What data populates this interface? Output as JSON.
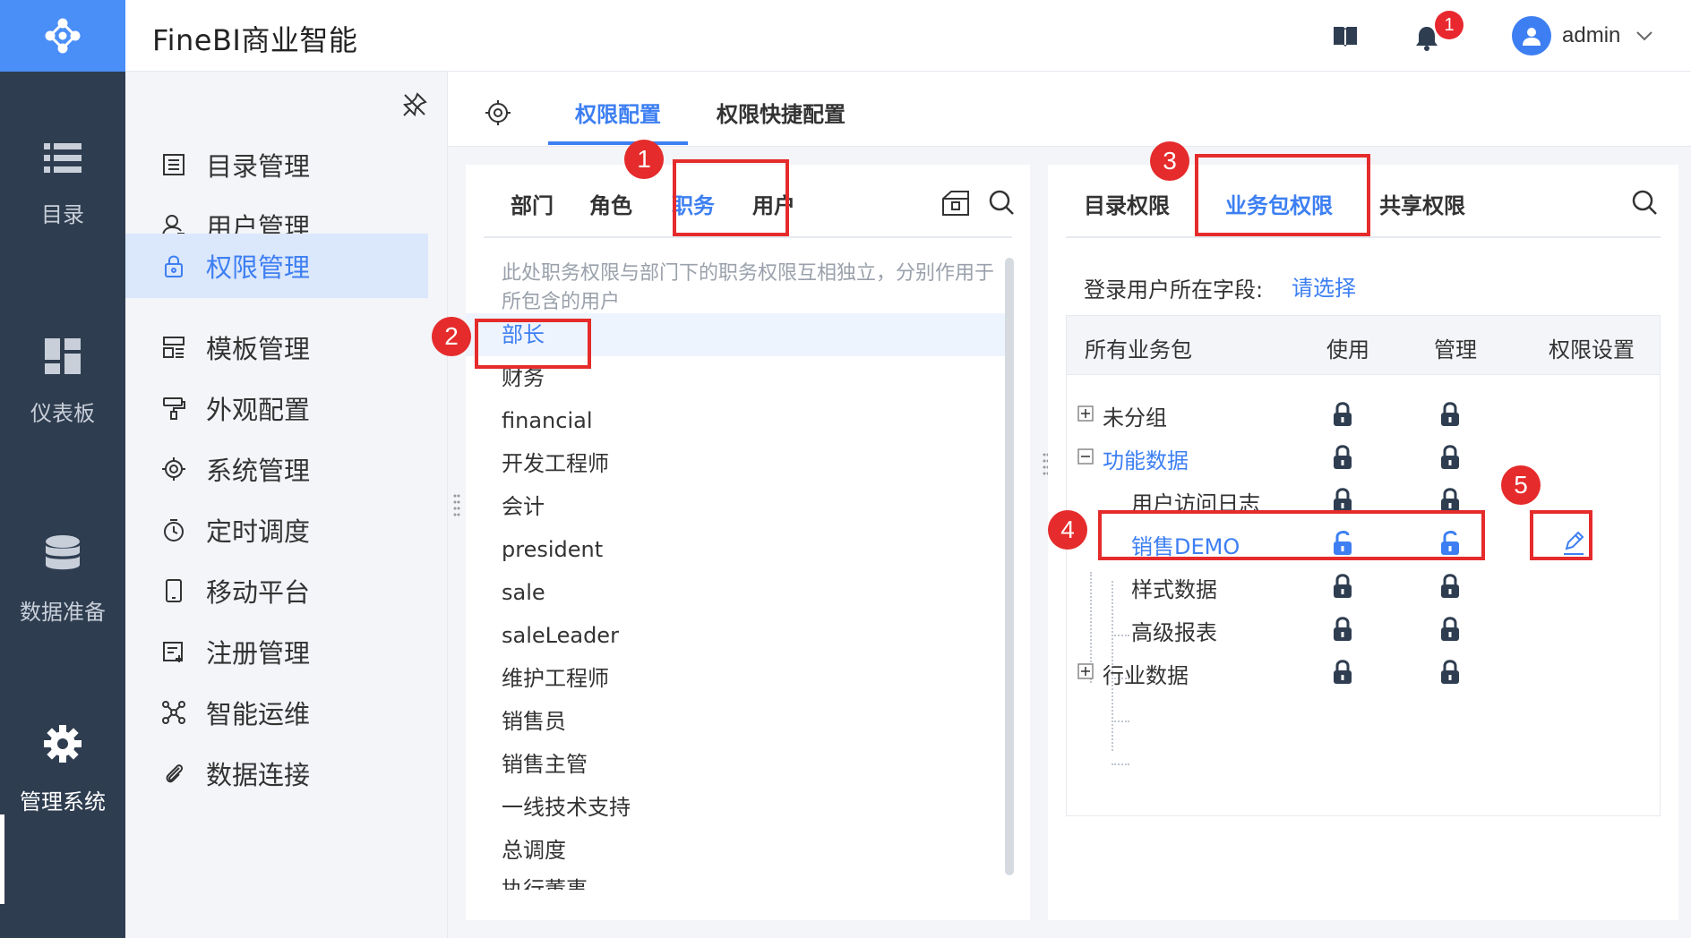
{
  "header": {
    "app_title": "FineBI商业智能",
    "notification_count": "1",
    "user_name": "admin"
  },
  "left_nav": {
    "items": [
      {
        "label": "目录",
        "icon": "list-icon"
      },
      {
        "label": "仪表板",
        "icon": "dashboard-icon"
      },
      {
        "label": "数据准备",
        "icon": "database-icon"
      },
      {
        "label": "管理系统",
        "icon": "gear-icon",
        "active": true
      }
    ]
  },
  "sidebar": {
    "items": [
      {
        "label": "目录管理",
        "icon": "catalog-icon"
      },
      {
        "label": "用户管理",
        "icon": "user-icon"
      },
      {
        "label": "权限管理",
        "icon": "lock-icon",
        "active": true
      },
      {
        "label": "模板管理",
        "icon": "template-icon"
      },
      {
        "label": "外观配置",
        "icon": "brush-icon"
      },
      {
        "label": "系统管理",
        "icon": "gear-icon"
      },
      {
        "label": "定时调度",
        "icon": "timer-icon"
      },
      {
        "label": "移动平台",
        "icon": "mobile-icon"
      },
      {
        "label": "注册管理",
        "icon": "register-icon"
      },
      {
        "label": "智能运维",
        "icon": "network-icon"
      },
      {
        "label": "数据连接",
        "icon": "link-icon"
      }
    ]
  },
  "main_tabs": {
    "perm_config": "权限配置",
    "perm_quick": "权限快捷配置"
  },
  "left_panel": {
    "tabs": [
      "部门",
      "角色",
      "职务",
      "用户"
    ],
    "active_tab": "职务",
    "note": "此处职务权限与部门下的职务权限互相独立，分别作用于所包含的用户",
    "positions": [
      "部长",
      "财务",
      "financial",
      "开发工程师",
      "会计",
      "president",
      "sale",
      "saleLeader",
      "维护工程师",
      "销售员",
      "销售主管",
      "一线技术支持",
      "总调度",
      "执行董事"
    ],
    "selected": "部长"
  },
  "right_panel": {
    "tabs": [
      "目录权限",
      "业务包权限",
      "共享权限"
    ],
    "active_tab": "业务包权限",
    "login_field_label": "登录用户所在字段:",
    "login_field_select": "请选择",
    "table_headers": [
      "所有业务包",
      "使用",
      "管理",
      "权限设置"
    ],
    "tree": [
      {
        "label": "未分组",
        "level": 0,
        "expander": "plus"
      },
      {
        "label": "功能数据",
        "level": 0,
        "expander": "minus"
      },
      {
        "label": "用户访问日志",
        "level": 1
      },
      {
        "label": "销售DEMO",
        "level": 1,
        "unlocked": true
      },
      {
        "label": "样式数据",
        "level": 1
      },
      {
        "label": "高级报表",
        "level": 1
      },
      {
        "label": "行业数据",
        "level": 0,
        "expander": "plus"
      }
    ]
  },
  "annotations": [
    "1",
    "2",
    "3",
    "4",
    "5"
  ],
  "colors": {
    "accent": "#3d7ff2",
    "nav_bg": "#2f3d50",
    "annotation": "#e52b2b"
  }
}
